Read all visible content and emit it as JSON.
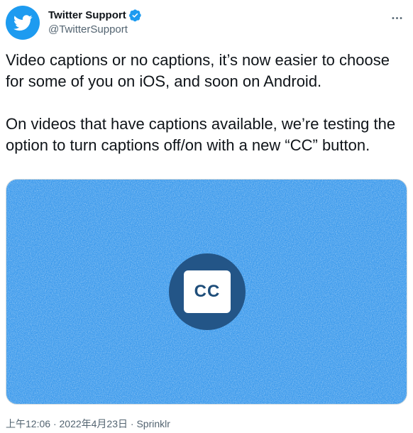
{
  "author": {
    "display_name": "Twitter Support",
    "handle": "@TwitterSupport",
    "avatar_icon": "twitter-bird-icon",
    "verified_icon": "verified-badge-icon"
  },
  "menu": {
    "more_icon": "more-horizontal-icon"
  },
  "tweet": {
    "paragraph_1": "Video captions or no captions, it’s now easier to choose for some of you on iOS, and soon on Android.",
    "paragraph_2": "On videos that have captions available, we’re testing the option to turn captions off/on with a new “CC” button."
  },
  "media": {
    "button_label": "CC",
    "background_color": "#3c9aec",
    "circle_color": "#235587"
  },
  "meta": {
    "time": "上午12:06",
    "separator": "·",
    "date": "2022年4月23日",
    "source": "Sprinklr"
  },
  "colors": {
    "accent": "#1d9bf0",
    "text_primary": "#0f1419",
    "text_secondary": "#536471"
  }
}
